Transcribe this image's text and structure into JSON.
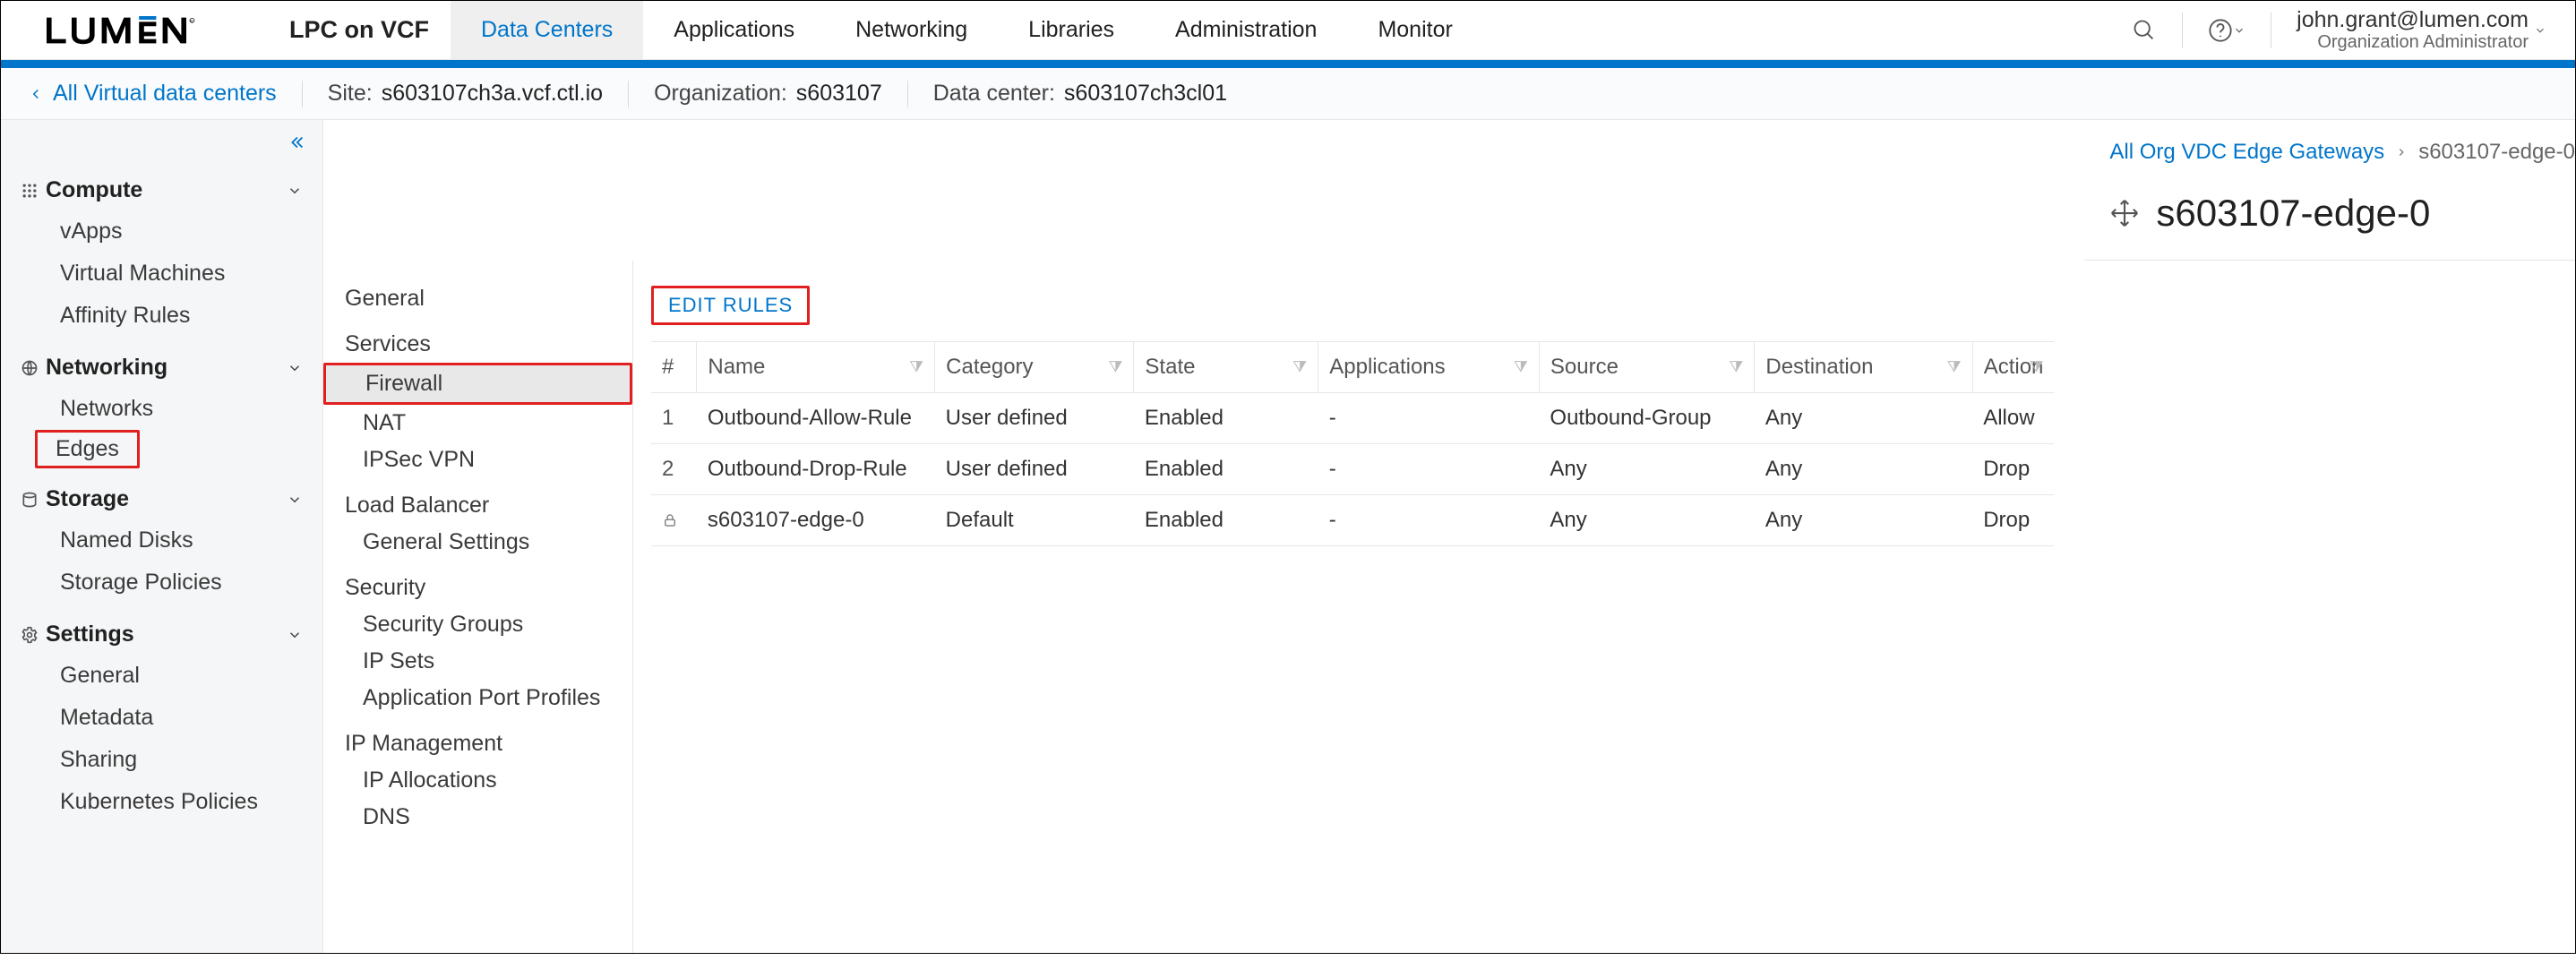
{
  "header": {
    "app_title": "LPC on VCF",
    "tabs": [
      {
        "label": "Data Centers",
        "active": true
      },
      {
        "label": "Applications"
      },
      {
        "label": "Networking"
      },
      {
        "label": "Libraries"
      },
      {
        "label": "Administration"
      },
      {
        "label": "Monitor"
      }
    ],
    "user_email": "john.grant@lumen.com",
    "user_role": "Organization Administrator"
  },
  "context": {
    "back_label": "All Virtual data centers",
    "site_label": "Site:",
    "site_value": "s603107ch3a.vcf.ctl.io",
    "org_label": "Organization:",
    "org_value": "s603107",
    "dc_label": "Data center:",
    "dc_value": "s603107ch3cl01"
  },
  "left_nav": {
    "groups": [
      {
        "title": "Compute",
        "items": [
          "vApps",
          "Virtual Machines",
          "Affinity Rules"
        ]
      },
      {
        "title": "Networking",
        "items": [
          "Networks",
          "Edges"
        ],
        "highlight_index": 1
      },
      {
        "title": "Storage",
        "items": [
          "Named Disks",
          "Storage Policies"
        ]
      },
      {
        "title": "Settings",
        "items": [
          "General",
          "Metadata",
          "Sharing",
          "Kubernetes Policies"
        ]
      }
    ]
  },
  "breadcrumb": {
    "root": "All Org VDC Edge Gateways",
    "current": "s603107-edge-0"
  },
  "page_title": "s603107-edge-0",
  "detail_nav": {
    "general": "General",
    "services_label": "Services",
    "services": [
      "Firewall",
      "NAT",
      "IPSec VPN"
    ],
    "services_active_index": 0,
    "services_highlight_index": 0,
    "lb_label": "Load Balancer",
    "lb": [
      "General Settings"
    ],
    "security_label": "Security",
    "security": [
      "Security Groups",
      "IP Sets",
      "Application Port Profiles"
    ],
    "ipm_label": "IP Management",
    "ipm": [
      "IP Allocations",
      "DNS"
    ]
  },
  "content": {
    "edit_rules_label": "EDIT RULES",
    "columns": [
      "#",
      "Name",
      "Category",
      "State",
      "Applications",
      "Source",
      "Destination",
      "Action"
    ],
    "rows": [
      {
        "index": "1",
        "name": "Outbound-Allow-Rule",
        "category": "User defined",
        "state": "Enabled",
        "applications": "-",
        "source": "Outbound-Group",
        "destination": "Any",
        "action": "Allow"
      },
      {
        "index": "2",
        "name": "Outbound-Drop-Rule",
        "category": "User defined",
        "state": "Enabled",
        "applications": "-",
        "source": "Any",
        "destination": "Any",
        "action": "Drop"
      },
      {
        "index": "lock",
        "name": "s603107-edge-0",
        "category": "Default",
        "state": "Enabled",
        "applications": "-",
        "source": "Any",
        "destination": "Any",
        "action": "Drop"
      }
    ]
  }
}
